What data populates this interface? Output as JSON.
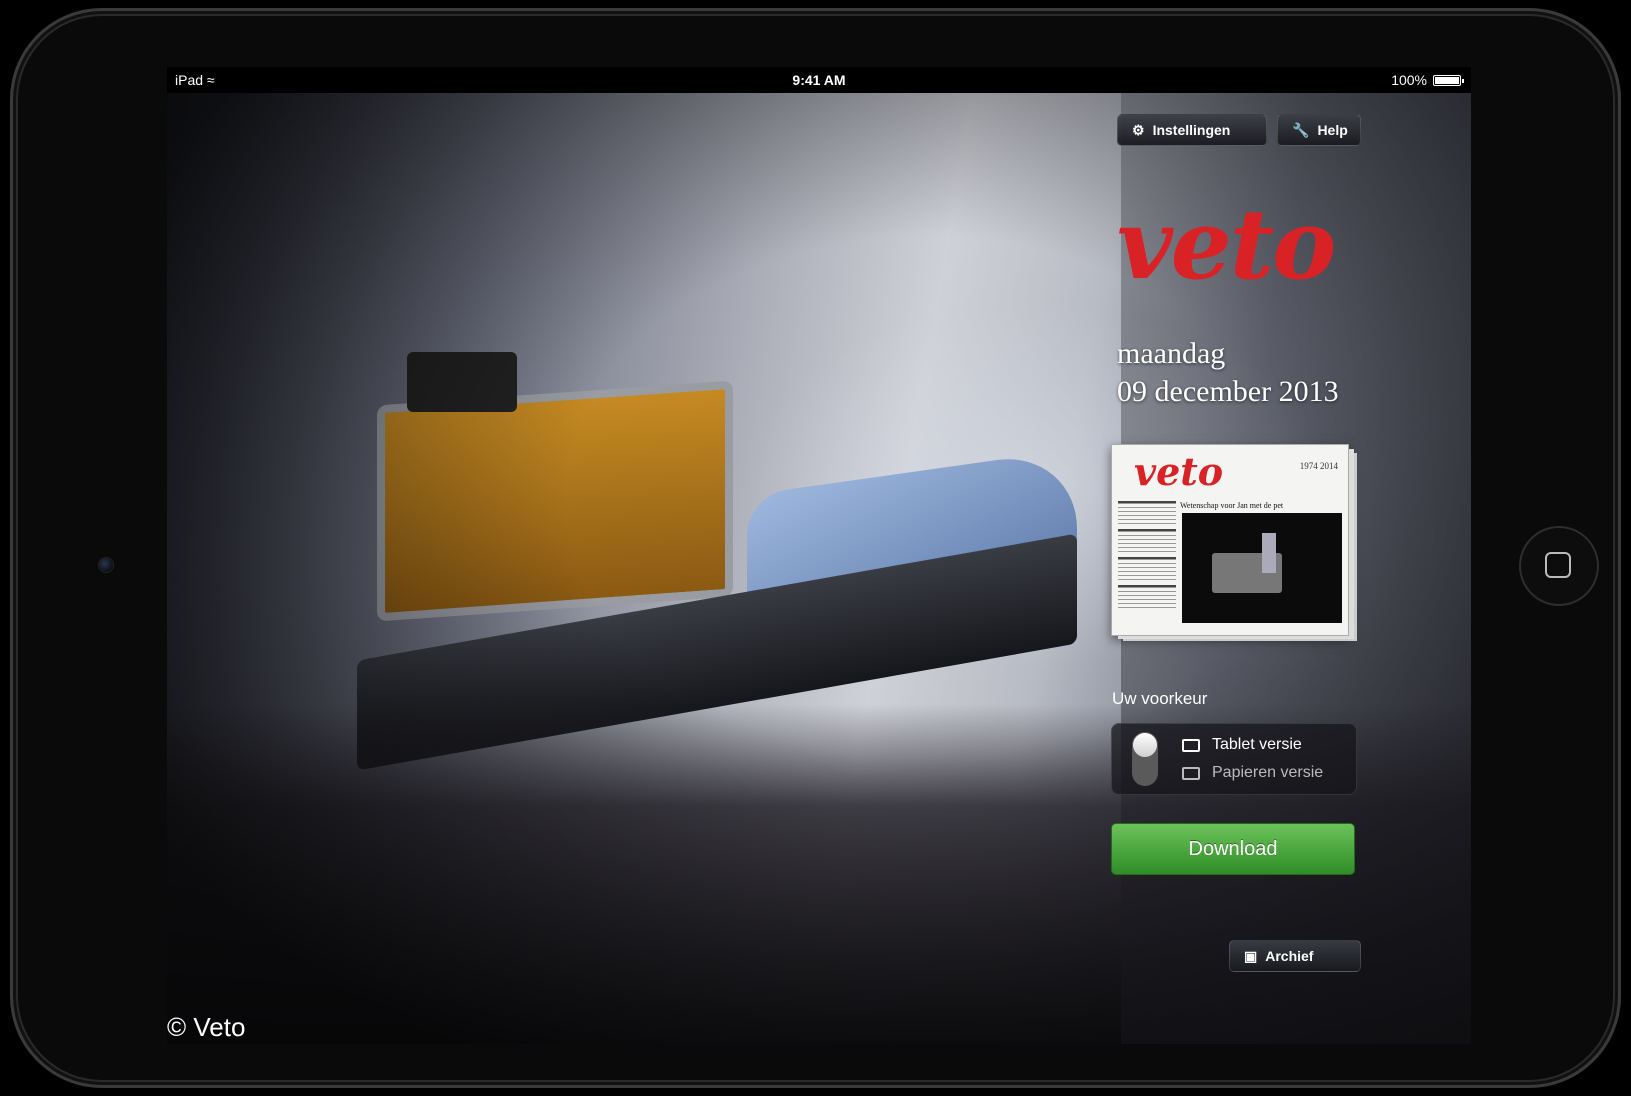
{
  "status_bar": {
    "device": "iPad",
    "time": "9:41 AM",
    "battery": "100%"
  },
  "toolbar": {
    "settings_label": "Instellingen",
    "help_label": "Help"
  },
  "brand": {
    "logo_text": "veto",
    "color": "#d92226"
  },
  "issue": {
    "day": "maandag",
    "date": "09 december 2013",
    "cover": {
      "logo_text": "veto",
      "years": "1974   2014",
      "headline": "Wetenschap voor Jan met de pet"
    }
  },
  "preference": {
    "label": "Uw voorkeur",
    "options": [
      {
        "label": "Tablet versie",
        "icon": "tablet-icon",
        "selected": true
      },
      {
        "label": "Papieren versie",
        "icon": "paper-icon",
        "selected": false
      }
    ]
  },
  "download_label": "Download",
  "archive_label": "Archief",
  "copyright": "© Veto",
  "colors": {
    "download_green": "#3a9a30",
    "panel_dark": "#1a1a1e"
  }
}
